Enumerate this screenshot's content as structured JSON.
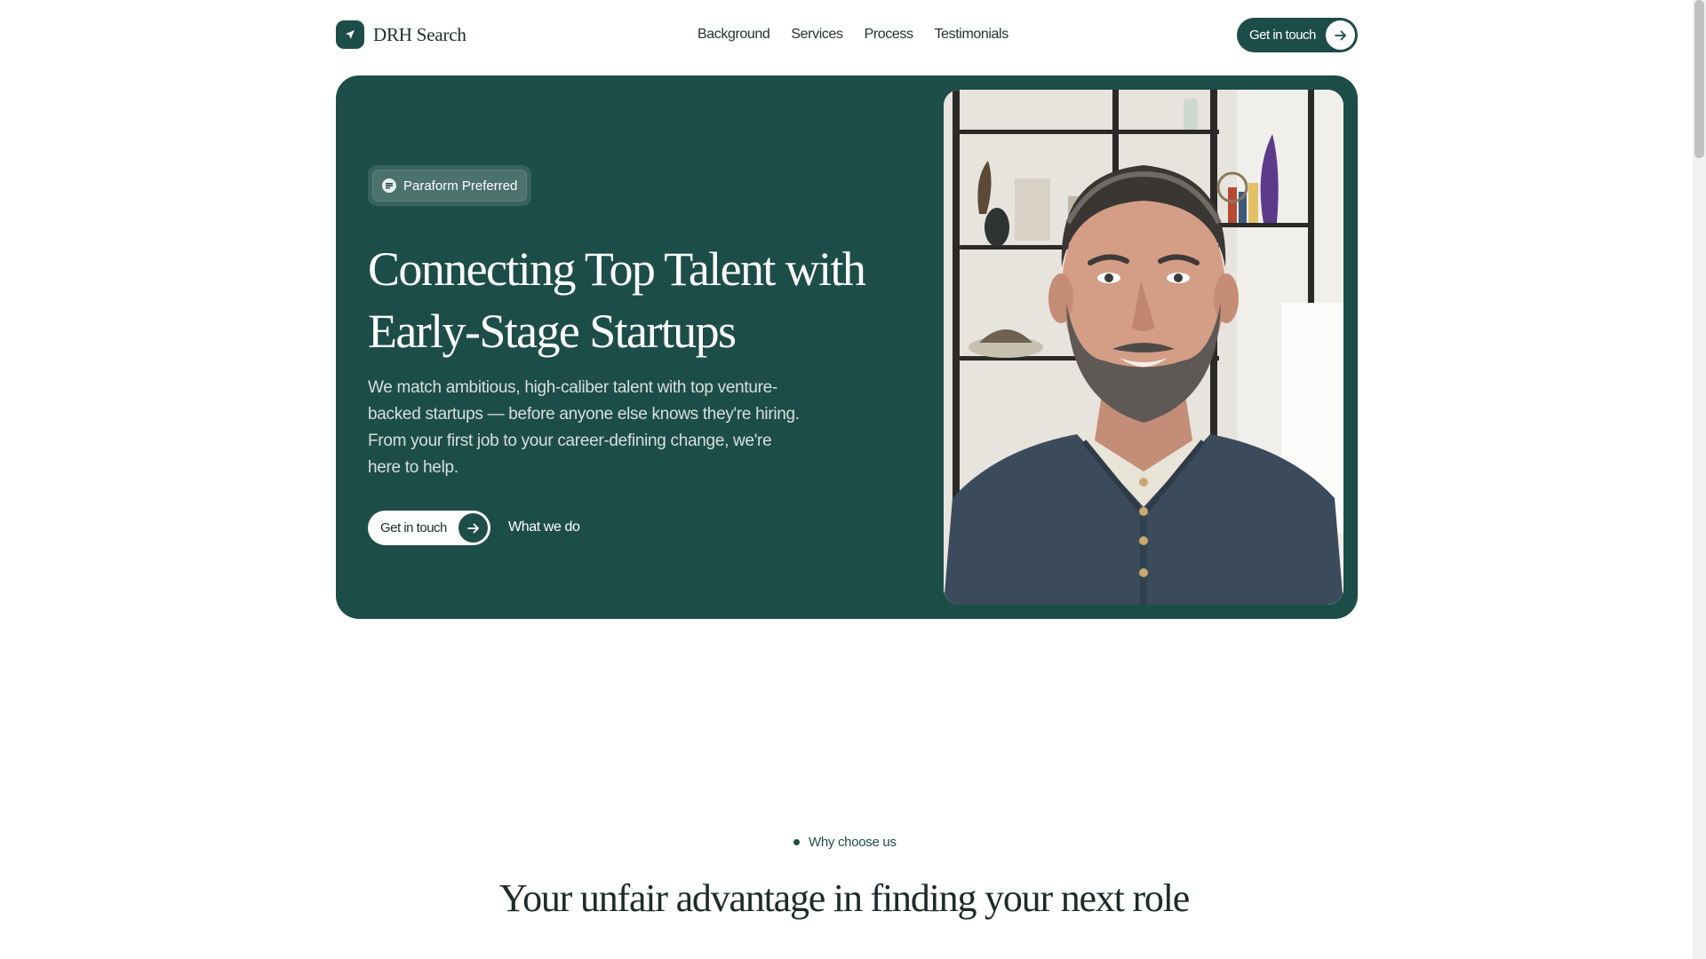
{
  "header": {
    "brand_name": "DRH Search",
    "nav": [
      {
        "label": "Background"
      },
      {
        "label": "Services"
      },
      {
        "label": "Process"
      },
      {
        "label": "Testimonials"
      }
    ],
    "cta_label": "Get in touch"
  },
  "hero": {
    "badge_label": "Paraform Preferred",
    "title_line1": "Connecting Top Talent with",
    "title_line2": "Early-Stage Startups",
    "description": "We match ambitious, high-caliber talent with top venture-backed startups — before anyone else knows they're hiring. From your first job to your career-defining change, we're here to help.",
    "primary_cta": "Get in touch",
    "secondary_cta": "What we do"
  },
  "why": {
    "tag": "Why choose us",
    "title": "Your unfair advantage in finding your next role"
  },
  "icons": {
    "brand": "paper-plane-icon",
    "cta": "arrow-right-icon",
    "badge": "paraform-logo-icon"
  },
  "colors": {
    "brand_green": "#1d4d48",
    "background": "#ffffff",
    "text_dark": "#1d2b2a"
  }
}
